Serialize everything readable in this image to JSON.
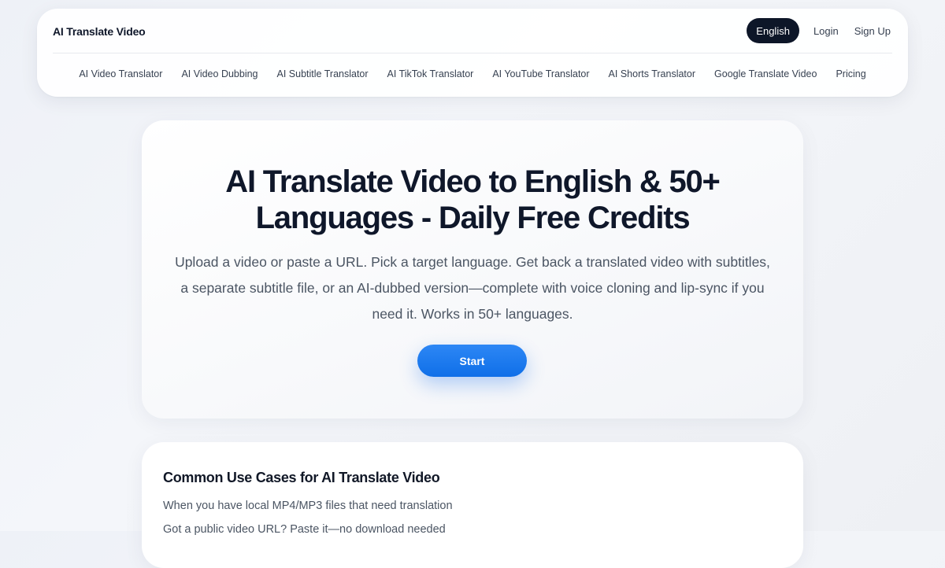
{
  "header": {
    "brand": "AI Translate Video",
    "language_button": "English",
    "login_label": "Login",
    "signup_label": "Sign Up",
    "nav": [
      "AI Video Translator",
      "AI Video Dubbing",
      "AI Subtitle Translator",
      "AI TikTok Translator",
      "AI YouTube Translator",
      "AI Shorts Translator",
      "Google Translate Video",
      "Pricing"
    ]
  },
  "hero": {
    "title_line1": "AI Translate Video to English & 50+",
    "title_line2": "Languages - Daily Free Credits",
    "subtitle": "Upload a video or paste a URL. Pick a target language. Get back a translated video with subtitles, a separate subtitle file, or an AI-dubbed version—complete with voice cloning and lip-sync if you need it. Works in 50+ languages.",
    "start_label": "Start"
  },
  "use_cases": {
    "title": "Common Use Cases for AI Translate Video",
    "items": [
      "When you have local MP4/MP3 files that need translation",
      "Got a public video URL? Paste it—no download needed"
    ]
  },
  "colors": {
    "accent": "#1a7cf0",
    "dark_button": "#0d1628"
  }
}
